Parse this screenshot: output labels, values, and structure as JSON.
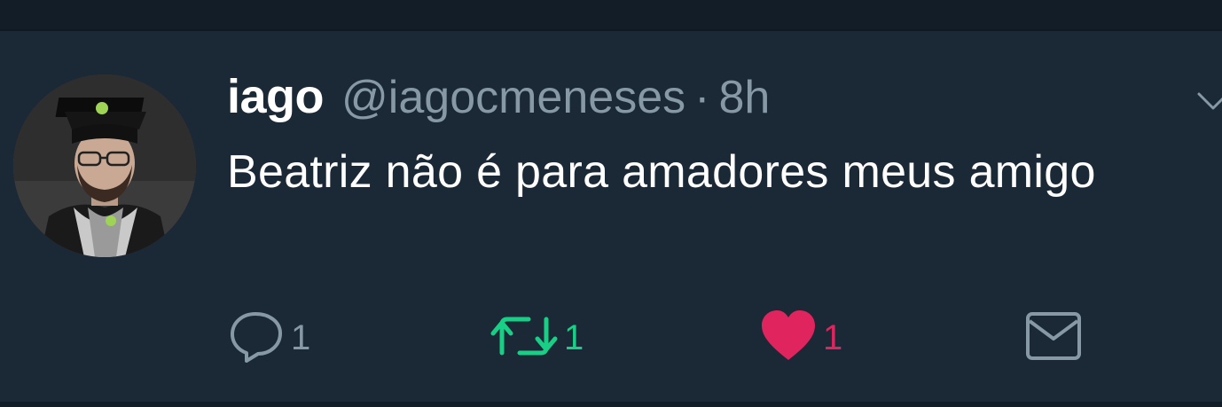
{
  "tweet": {
    "display_name": "iago",
    "handle": "@iagocmeneses",
    "separator": "·",
    "time": "8h",
    "text": "Beatriz não é para amadores meus amigo",
    "actions": {
      "reply_count": "1",
      "retweet_count": "1",
      "like_count": "1"
    }
  },
  "colors": {
    "background": "#1b2836",
    "secondary_text": "#8899a6",
    "retweet_green": "#19cf86",
    "like_pink": "#e0245e"
  },
  "icons": [
    "reply-icon",
    "retweet-icon",
    "heart-icon",
    "envelope-icon",
    "chevron-down-icon"
  ]
}
